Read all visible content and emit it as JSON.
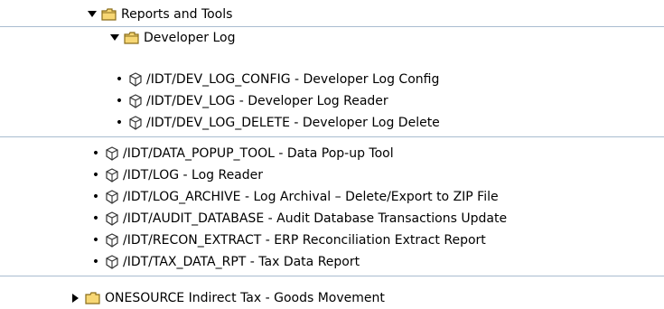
{
  "tree": {
    "reports_and_tools": {
      "label": "Reports and Tools",
      "icon": "folder-open-icon",
      "toggle": "expanded-triangle-icon"
    },
    "developer_log": {
      "label": "Developer Log",
      "icon": "folder-open-icon",
      "toggle": "expanded-triangle-icon",
      "items": [
        {
          "label": "/IDT/DEV_LOG_CONFIG - Developer Log Config"
        },
        {
          "label": "/IDT/DEV_LOG - Developer Log Reader"
        },
        {
          "label": "/IDT/DEV_LOG_DELETE - Developer Log Delete"
        }
      ]
    },
    "tools": [
      {
        "label": "/IDT/DATA_POPUP_TOOL - Data Pop-up Tool"
      },
      {
        "label": "/IDT/LOG - Log Reader"
      },
      {
        "label": "/IDT/LOG_ARCHIVE - Log Archival – Delete/Export to ZIP File"
      },
      {
        "label": "/IDT/AUDIT_DATABASE - Audit Database Transactions Update"
      },
      {
        "label": "/IDT/RECON_EXTRACT - ERP Reconciliation Extract Report"
      },
      {
        "label": "/IDT/TAX_DATA_RPT - Tax Data Report"
      }
    ],
    "next_folder": {
      "label": "ONESOURCE Indirect Tax - Goods Movement",
      "icon": "folder-closed-icon",
      "toggle": "collapsed-triangle-icon"
    }
  },
  "colors": {
    "separator": "#a9bcd0",
    "folder_fill": "#f7d774",
    "folder_stroke": "#8a6d1a",
    "transaction_icon_stroke": "#333333"
  }
}
